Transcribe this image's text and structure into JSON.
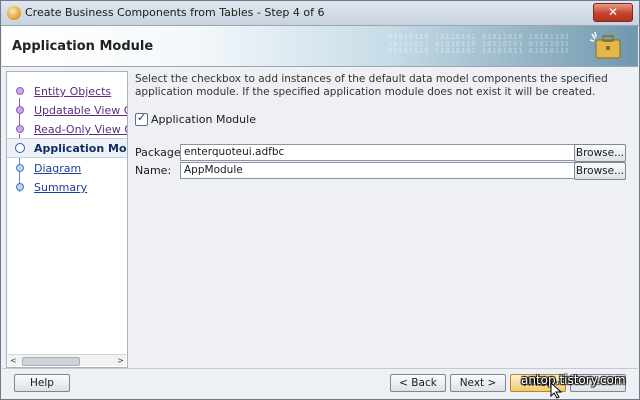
{
  "window": {
    "title": "Create Business Components from Tables - Step 4 of 6",
    "close_glyph": "✕"
  },
  "header": {
    "title": "Application Module",
    "icon": "briefcase-icon"
  },
  "nav": {
    "items": [
      {
        "label": "Entity Objects",
        "state": "visited"
      },
      {
        "label": "Updatable View Objects",
        "state": "visited"
      },
      {
        "label": "Read-Only View Objects",
        "state": "visited"
      },
      {
        "label": "Application Module",
        "state": "current"
      },
      {
        "label": "Diagram",
        "state": "pending"
      },
      {
        "label": "Summary",
        "state": "pending"
      }
    ],
    "scroll_left": "<",
    "scroll_right": ">"
  },
  "content": {
    "instruction": "Select the checkbox to add instances of the default data model components the specified application module.  If the specified application module does not exist it will be created.",
    "checkbox": {
      "label": "Application Module",
      "checked": true
    },
    "package": {
      "label": "Package:",
      "value": "enterquoteui.adfbc",
      "browse_label": "Browse..."
    },
    "name": {
      "label": "Name:",
      "value": "AppModule",
      "browse_label": "Browse..."
    }
  },
  "footer": {
    "help_label": "Help",
    "back_label": "< Back",
    "next_label": "Next >",
    "finish_label": "Finish"
  },
  "watermark": "antop.tistory.com"
}
